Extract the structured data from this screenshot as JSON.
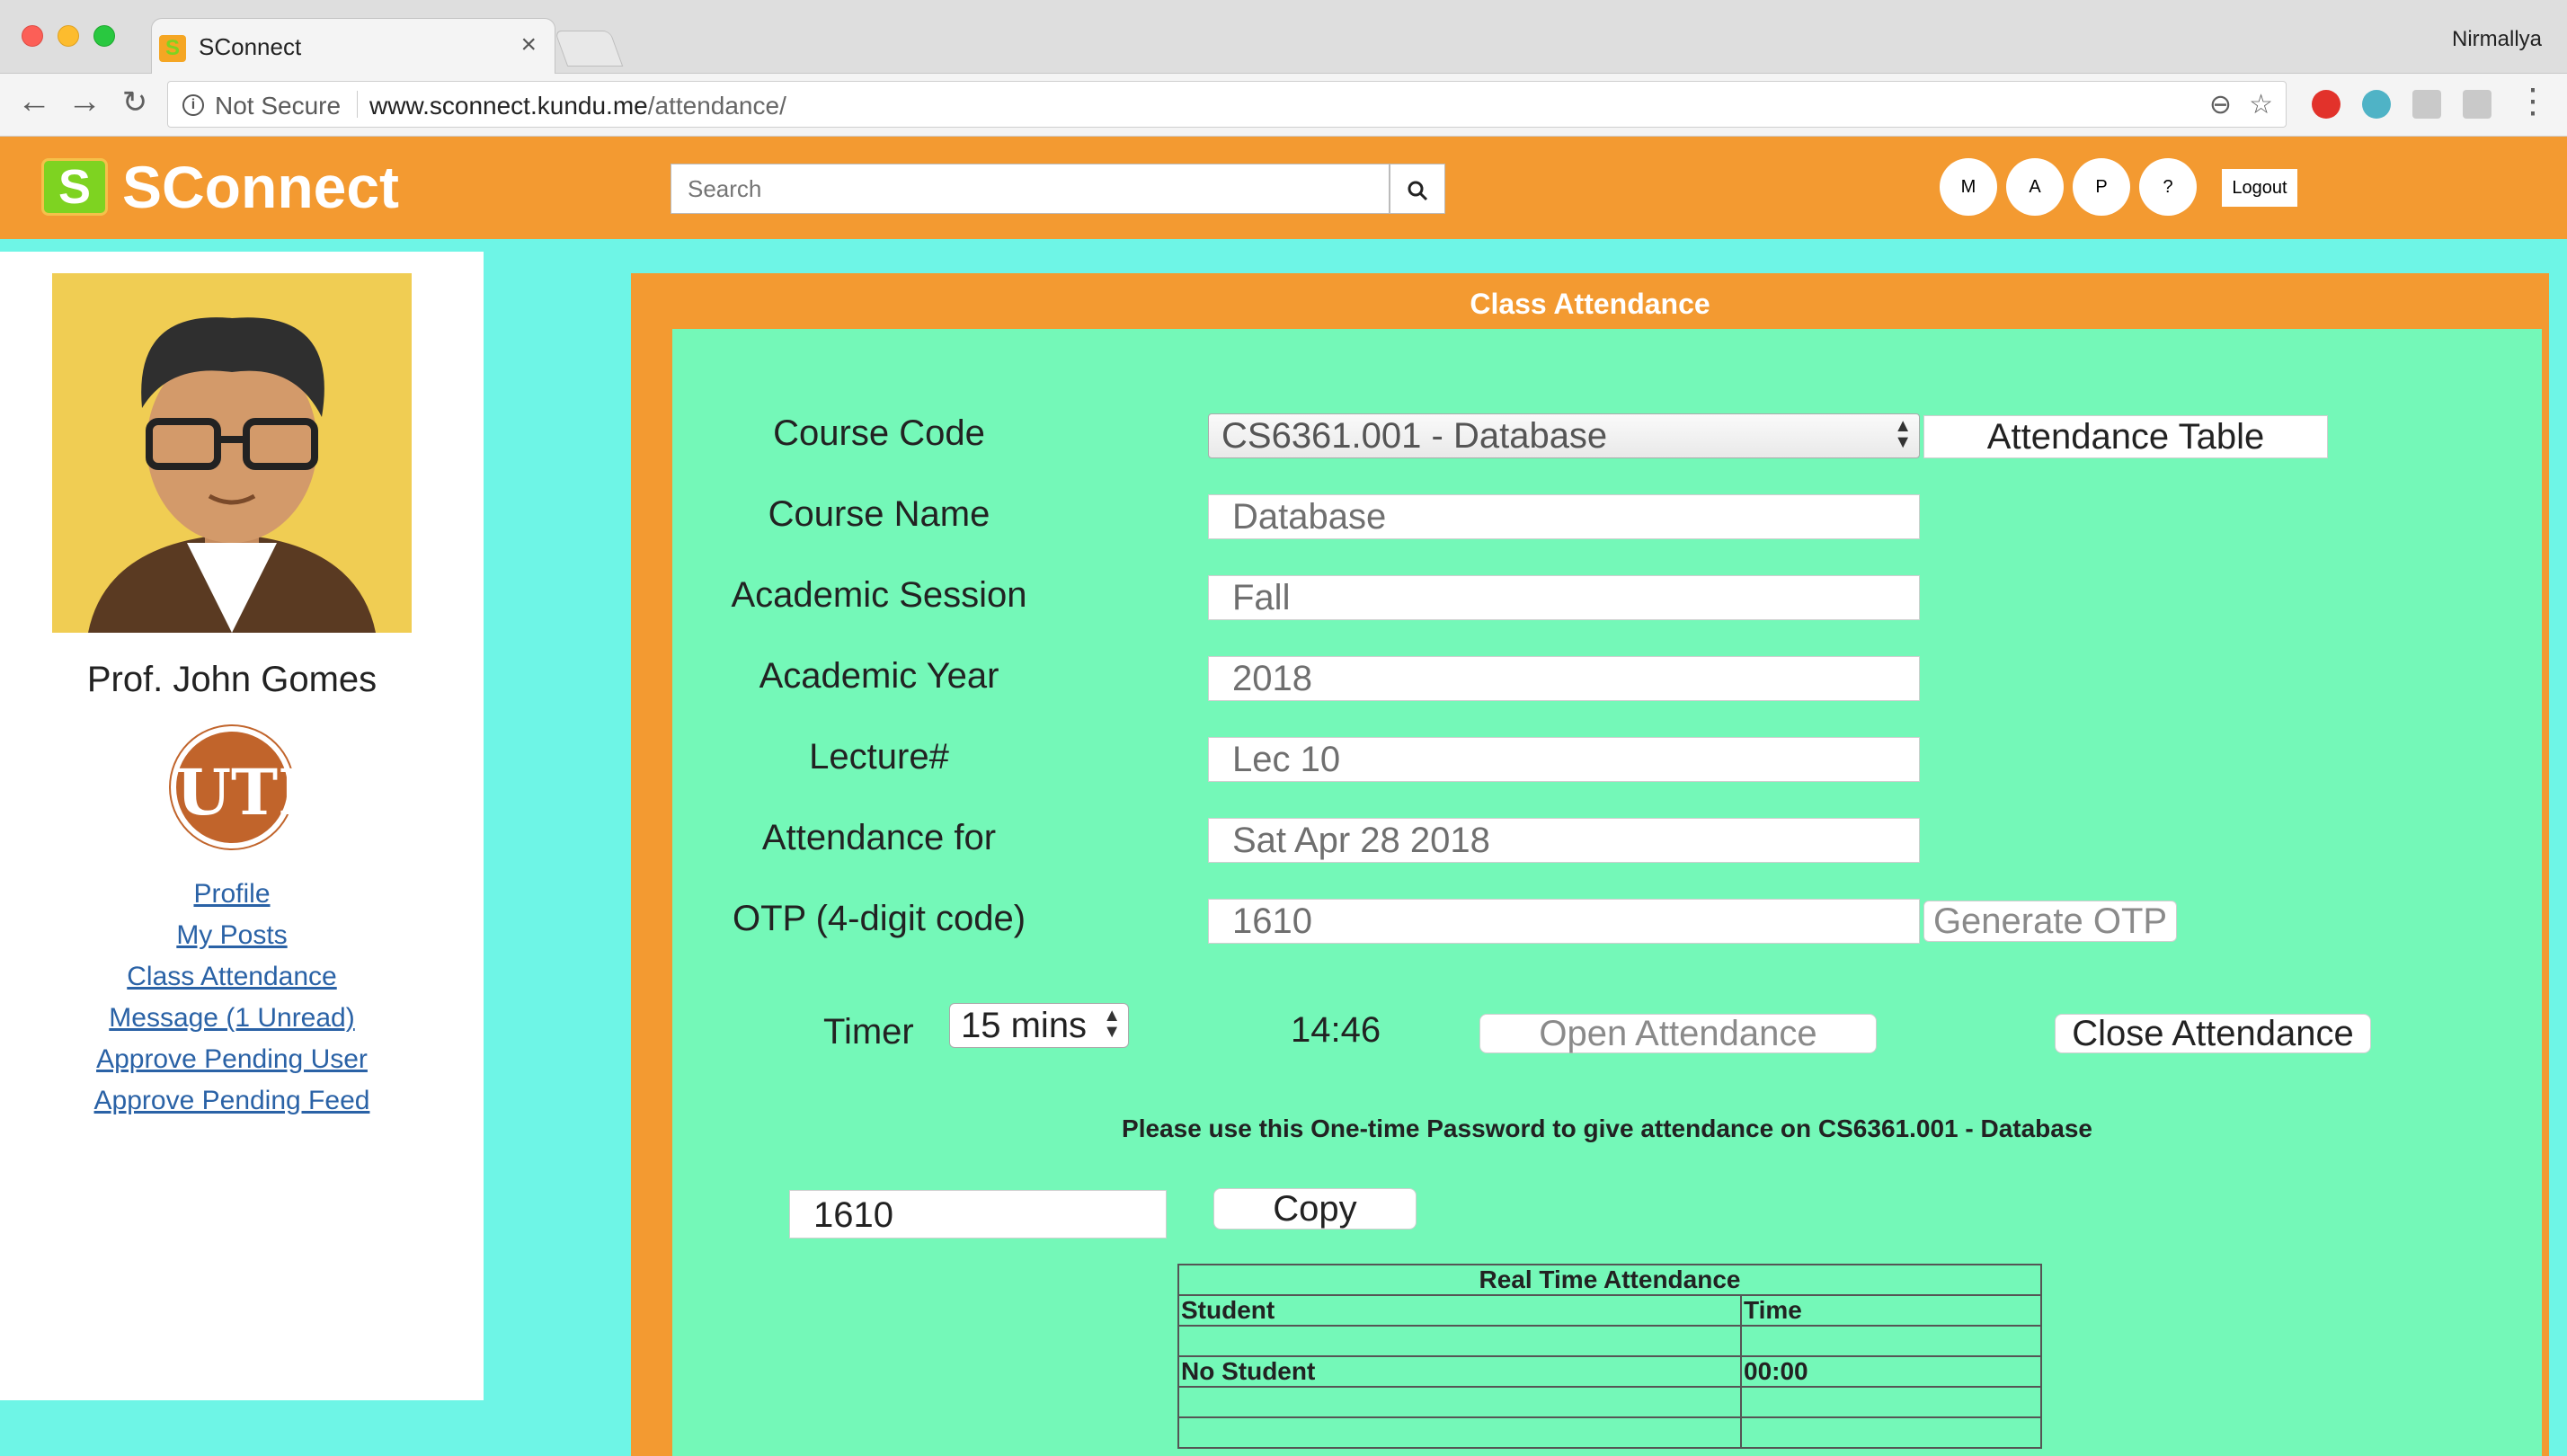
{
  "browser": {
    "tab_title": "SConnect",
    "tab_close": "×",
    "profile_name": "Nirmallya",
    "security_label": "Not Secure",
    "url_host": "www.sconnect.kundu.me",
    "url_path": "/attendance/"
  },
  "header": {
    "logo_letter": "S",
    "logo_text": "SConnect",
    "search_placeholder": "Search",
    "circle_buttons": [
      "M",
      "A",
      "P",
      "?"
    ],
    "logout_label": "Logout"
  },
  "sidebar": {
    "name": "Prof. John Gomes",
    "university_logo_text": "UTD",
    "links": [
      "Profile",
      "My Posts",
      "Class Attendance",
      "Message (1 Unread)",
      "Approve Pending User",
      "Approve Pending Feed"
    ]
  },
  "panel": {
    "title": "Class Attendance",
    "labels": {
      "course_code": "Course Code",
      "course_name": "Course Name",
      "academic_session": "Academic Session",
      "academic_year": "Academic Year",
      "lecture": "Lecture#",
      "attendance_for": "Attendance for",
      "otp": "OTP (4-digit code)",
      "timer": "Timer"
    },
    "values": {
      "course_code": "CS6361.001 - Database",
      "course_name": "Database",
      "academic_session": "Fall",
      "academic_year": "2018",
      "lecture": "Lec 10",
      "attendance_for": "Sat Apr 28 2018",
      "otp": "1610",
      "timer": "15 mins",
      "countdown": "14:46"
    },
    "buttons": {
      "attendance_table": "Attendance Table",
      "generate_otp": "Generate OTP",
      "open_attendance": "Open Attendance",
      "close_attendance": "Close Attendance",
      "copy": "Copy"
    },
    "otp_message": "Please use this One-time Password to give attendance on CS6361.001 - Database",
    "otp_share_value": "1610"
  },
  "realtime_table": {
    "caption": "Real Time Attendance",
    "columns": [
      "Student",
      "Time"
    ],
    "rows": [
      [
        "No Student",
        "00:00"
      ]
    ]
  }
}
